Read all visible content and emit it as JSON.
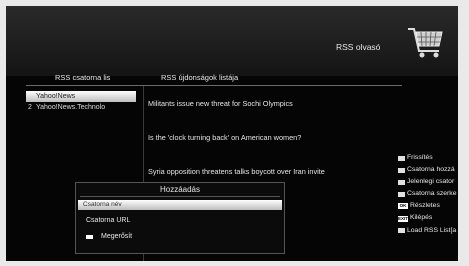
{
  "header": {
    "title": "RSS olvasó",
    "cart_icon": "shopping-cart-icon"
  },
  "columns": {
    "left_header": "RSS csatorna lis",
    "right_header": "RSS újdonságok listája"
  },
  "feeds": [
    {
      "num": "",
      "label": "Yahoo!News",
      "selected": true
    },
    {
      "num": "2",
      "label": "Yahoo!News.Technolo",
      "selected": false
    }
  ],
  "news": [
    "Militants issue new threat for Sochi Olympics",
    "Is the 'clock turning back' on American women?",
    "Syria opposition threatens talks boycott over Iran invite"
  ],
  "sidebar": [
    {
      "key": "red",
      "label": "Frissítés"
    },
    {
      "key": "green",
      "label": "Csatorna hozzá"
    },
    {
      "key": "yellow",
      "label": "Jelenlegi csator"
    },
    {
      "key": "blue",
      "label": "Csatorna szerke"
    },
    {
      "key": "OK",
      "label": "Részletes"
    },
    {
      "key": "EXIT",
      "label": "Kilépés"
    },
    {
      "key": "white",
      "label": "Load RSS List[a"
    }
  ],
  "dialog": {
    "title": "Hozzáadás",
    "name_field": "Csatorna név",
    "url_label": "Csatorna URL",
    "confirm_label": "Megerősít"
  }
}
